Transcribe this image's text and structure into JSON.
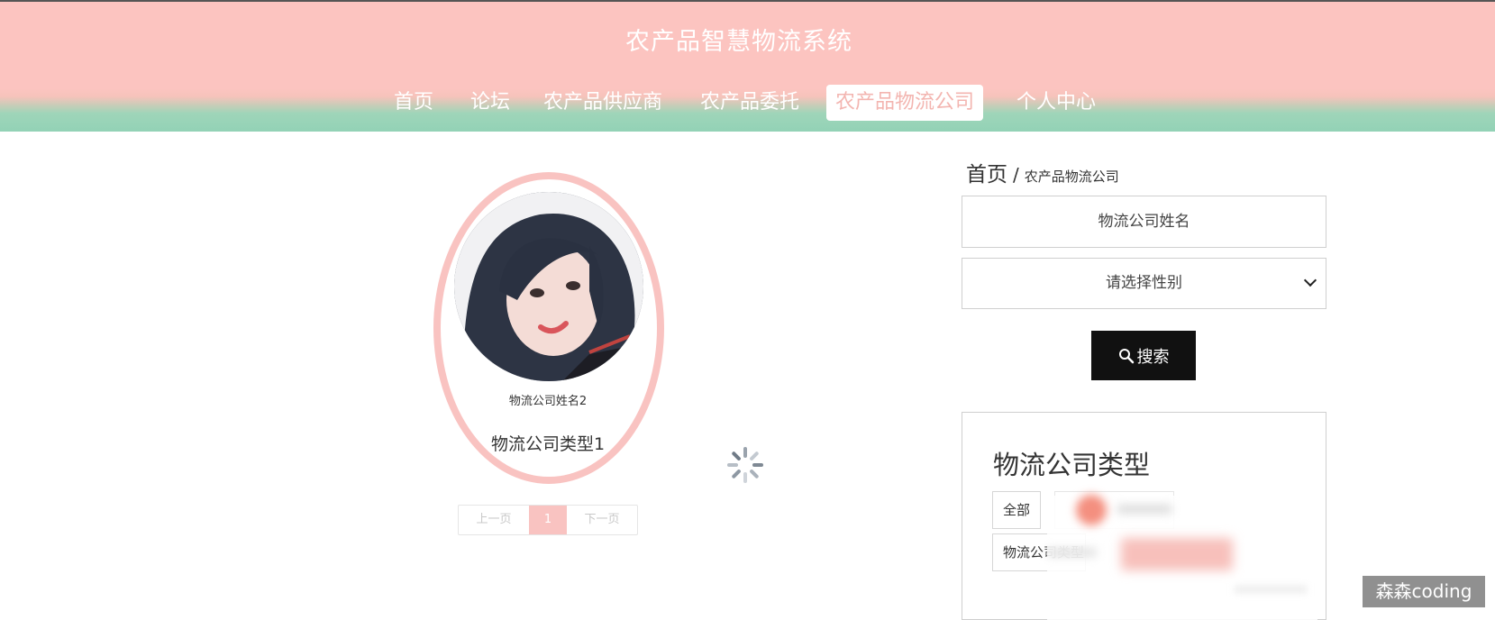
{
  "header": {
    "site_title": "农产品智慧物流系统",
    "nav": [
      {
        "label": "首页"
      },
      {
        "label": "论坛"
      },
      {
        "label": "农产品供应商"
      },
      {
        "label": "农产品委托"
      },
      {
        "label": "农产品物流公司",
        "active": true
      },
      {
        "label": "个人中心"
      }
    ]
  },
  "list": {
    "items": [
      {
        "name": "物流公司姓名2",
        "type": "物流公司类型1"
      }
    ],
    "pagination": {
      "prev": "上一页",
      "current": "1",
      "next": "下一页"
    }
  },
  "sidebar": {
    "breadcrumb": {
      "home": "首页",
      "separator": "/",
      "current": "农产品物流公司"
    },
    "search": {
      "name_placeholder": "物流公司姓名",
      "gender_select": "请选择性别",
      "button_label": "搜索"
    },
    "type_filter": {
      "title": "物流公司类型",
      "chips": [
        "全部",
        "物流公司类型1"
      ]
    }
  },
  "watermark": "森森coding",
  "colors": {
    "header_pink": "#fcc4c0",
    "header_green": "#92d2b6",
    "accent_pink": "#f9c3c1",
    "button_black": "#111111"
  }
}
